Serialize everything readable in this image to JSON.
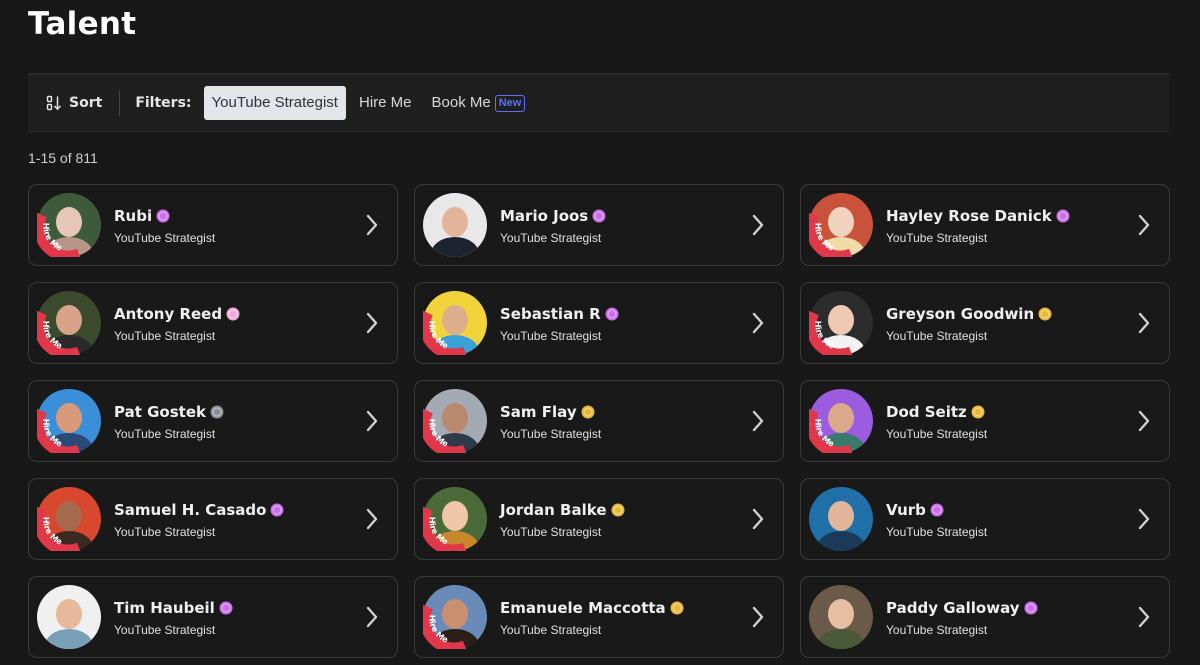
{
  "page": {
    "title": "Talent"
  },
  "toolbar": {
    "sort_label": "Sort",
    "filters_label": "Filters:",
    "filters": [
      {
        "label": "YouTube Strategist",
        "active": true
      },
      {
        "label": "Hire Me",
        "active": false
      },
      {
        "label": "Book Me",
        "active": false,
        "badge": "New"
      }
    ]
  },
  "results": {
    "count_text": "1-15 of 811"
  },
  "colors": {
    "background": "#181818",
    "card_border": "#3a3a3a",
    "hire_ring": "#e0384a",
    "badge_purple": "#c96ee8",
    "badge_pink": "#f0a9d8",
    "badge_gold": "#e8b83a",
    "badge_gray": "#8a8f99",
    "new_badge": "#5c6ff5"
  },
  "hire_ring_text": "Hire Me",
  "talent": [
    {
      "name": "Rubi",
      "role": "YouTube Strategist",
      "badge": "purple",
      "hire_me": true,
      "avatar_bg": "#3d5a3a",
      "face": "#e6c7b6",
      "shirt": "#b89685"
    },
    {
      "name": "Mario Joos",
      "role": "YouTube Strategist",
      "badge": "purple",
      "hire_me": false,
      "avatar_bg": "#e8e8e8",
      "face": "#e2b49a",
      "shirt": "#1d2330"
    },
    {
      "name": "Hayley Rose Danick",
      "role": "YouTube Strategist",
      "badge": "purple",
      "hire_me": true,
      "avatar_bg": "#c8533a",
      "face": "#efd3bf",
      "shirt": "#f1d9a8"
    },
    {
      "name": "Antony Reed",
      "role": "YouTube Strategist",
      "badge": "pink",
      "hire_me": true,
      "avatar_bg": "#3b4a2d",
      "face": "#d9a38a",
      "shirt": "#2a2a2a"
    },
    {
      "name": "Sebastian R",
      "role": "YouTube Strategist",
      "badge": "purple",
      "hire_me": true,
      "avatar_bg": "#f2d43a",
      "face": "#dcae8c",
      "shirt": "#3aa0d8"
    },
    {
      "name": "Greyson Goodwin",
      "role": "YouTube Strategist",
      "badge": "gold",
      "hire_me": true,
      "avatar_bg": "#2c2c2c",
      "face": "#efc9b4",
      "shirt": "#f2f2f2"
    },
    {
      "name": "Pat Gostek",
      "role": "YouTube Strategist",
      "badge": "gray",
      "hire_me": true,
      "avatar_bg": "#3a8fd8",
      "face": "#d99a7a",
      "shirt": "#2a4a7a"
    },
    {
      "name": "Sam Flay",
      "role": "YouTube Strategist",
      "badge": "gold",
      "hire_me": true,
      "avatar_bg": "#a4aab3",
      "face": "#b98a6e",
      "shirt": "#2f3a48"
    },
    {
      "name": "Dod Seitz",
      "role": "YouTube Strategist",
      "badge": "gold",
      "hire_me": true,
      "avatar_bg": "#9b5ce0",
      "face": "#dba88c",
      "shirt": "#3a7a6a"
    },
    {
      "name": "Samuel H. Casado",
      "role": "YouTube Strategist",
      "badge": "purple",
      "hire_me": true,
      "avatar_bg": "#d8482e",
      "face": "#a66b4e",
      "shirt": "#3a2a22"
    },
    {
      "name": "Jordan Balke",
      "role": "YouTube Strategist",
      "badge": "gold",
      "hire_me": true,
      "avatar_bg": "#4a6a3a",
      "face": "#efc6a8",
      "shirt": "#c8882a"
    },
    {
      "name": "Vurb",
      "role": "YouTube Strategist",
      "badge": "purple",
      "hire_me": false,
      "avatar_bg": "#1f6fa8",
      "face": "#e0b59a",
      "shirt": "#1a3a5a"
    },
    {
      "name": "Tim Haubeil",
      "role": "YouTube Strategist",
      "badge": "purple",
      "hire_me": false,
      "avatar_bg": "#f0f0f0",
      "face": "#e8b89a",
      "shirt": "#7aa0b8"
    },
    {
      "name": "Emanuele Maccotta",
      "role": "YouTube Strategist",
      "badge": "gold",
      "hire_me": true,
      "avatar_bg": "#6a8ab8",
      "face": "#c99070",
      "shirt": "#2a1e18"
    },
    {
      "name": "Paddy Galloway",
      "role": "YouTube Strategist",
      "badge": "purple",
      "hire_me": false,
      "avatar_bg": "#6b5a48",
      "face": "#e6bea4",
      "shirt": "#4a5a38"
    }
  ]
}
